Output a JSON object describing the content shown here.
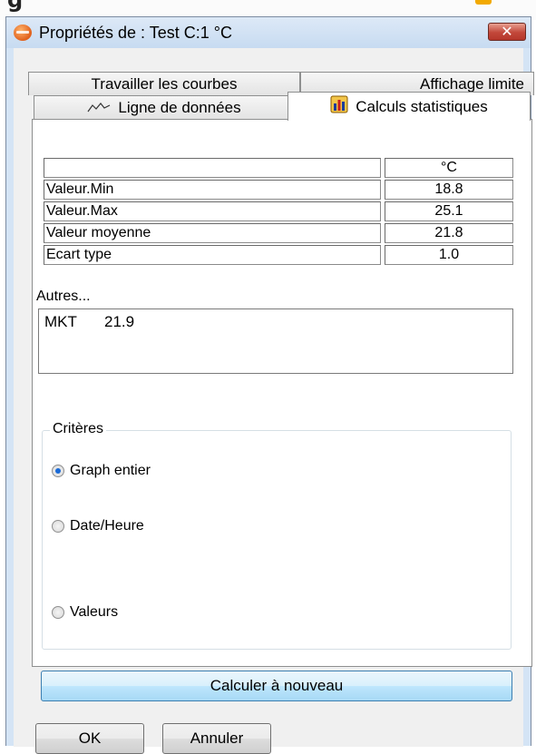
{
  "window": {
    "title": "Propriétés de : Test C:1 °C",
    "close_label": "✕"
  },
  "tabs": [
    {
      "label": "Travailler les courbes",
      "active": false
    },
    {
      "label": "Affichage limite",
      "active": false
    },
    {
      "label": "Ligne de données",
      "icon": "line-chart-icon",
      "active": false
    },
    {
      "label": "Calculs statistiques",
      "icon": "statistics-icon",
      "active": true
    }
  ],
  "stats": {
    "header": {
      "name": "",
      "unit": "°C"
    },
    "rows": [
      {
        "name": "Valeur.Min",
        "value": "18.8"
      },
      {
        "name": "Valeur.Max",
        "value": "25.1"
      },
      {
        "name": "Valeur moyenne",
        "value": "21.8"
      },
      {
        "name": "Ecart type",
        "value": "1.0"
      }
    ]
  },
  "others": {
    "label": "Autres...",
    "mkt_label": "MKT",
    "mkt_value": "21.9"
  },
  "criteria": {
    "title": "Critères",
    "options": [
      {
        "label": "Graph entier",
        "selected": true
      },
      {
        "label": "Date/Heure",
        "selected": false
      },
      {
        "label": "Valeurs",
        "selected": false
      }
    ]
  },
  "buttons": {
    "recalculate": "Calculer à nouveau",
    "ok": "OK",
    "cancel": "Annuler"
  },
  "colors": {
    "accent_orange": "#e0601c",
    "selected_radio": "#1a6ad6",
    "window_frame": "#d4e4f5"
  }
}
